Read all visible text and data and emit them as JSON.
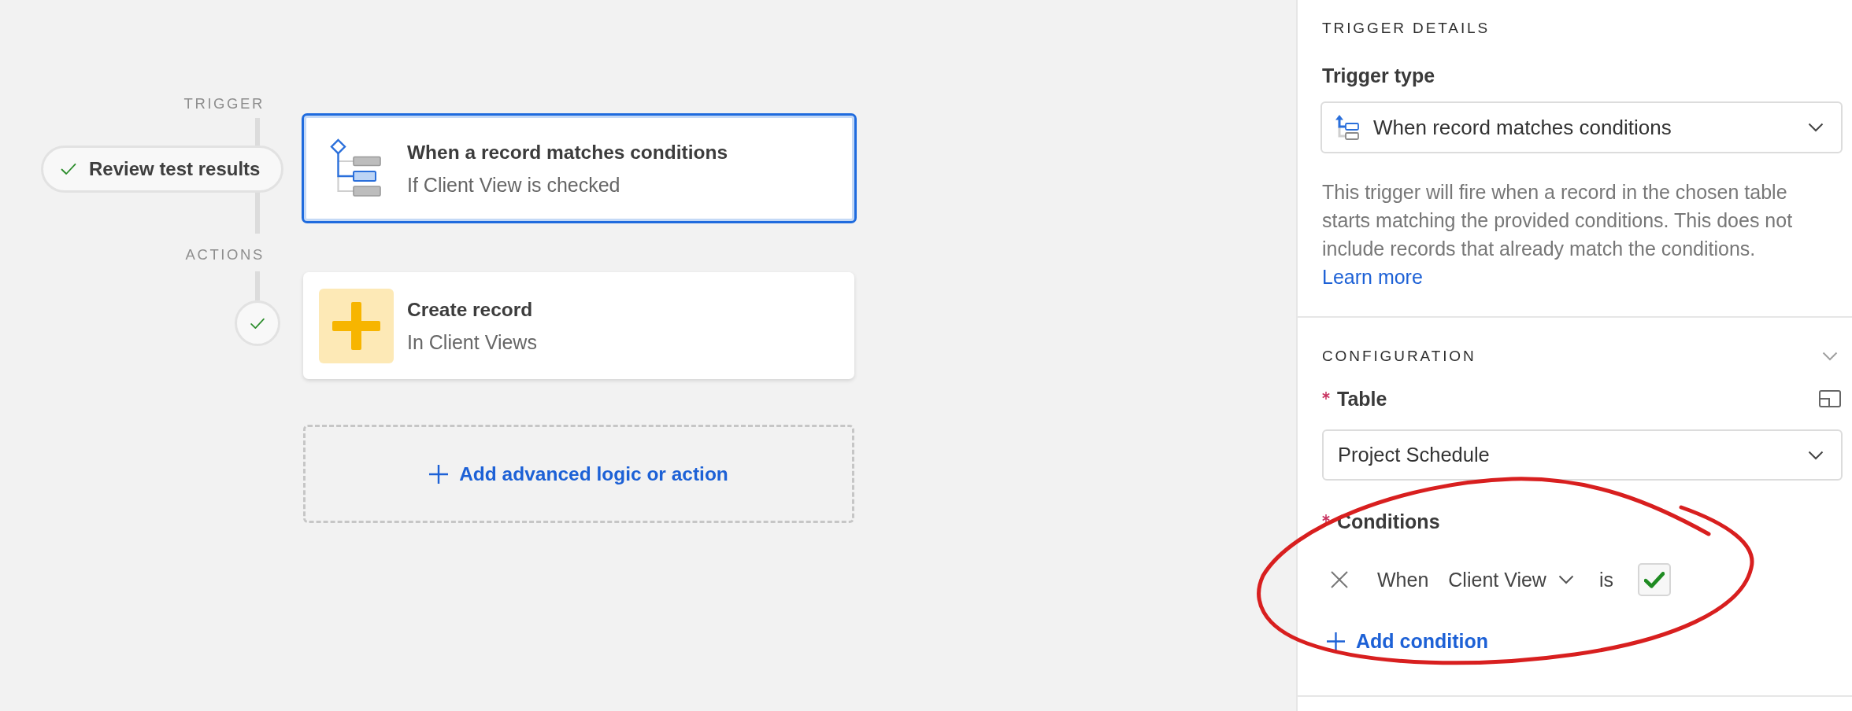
{
  "flow": {
    "trigger_label": "TRIGGER",
    "test_button": "Review test results",
    "trigger": {
      "title": "When a record matches conditions",
      "subtitle": "If Client View is checked",
      "selected": true
    },
    "actions_label": "ACTIONS",
    "actions": [
      {
        "kind": "create_record",
        "title": "Create record",
        "subtitle": "In Client Views",
        "selected": false,
        "tested": true
      }
    ],
    "add_step": "Add advanced logic or action"
  },
  "panel": {
    "heading": "TRIGGER DETAILS",
    "trigger_type": {
      "label": "Trigger type",
      "value": "When record matches conditions"
    },
    "description": "This trigger will fire when a record in the chosen table starts matching the provided conditions. This does not include records that already match the conditions.",
    "learn_more": "Learn more",
    "configuration": {
      "heading": "CONFIGURATION",
      "expanded": true,
      "table": {
        "label": "Table",
        "required": true,
        "value": "Project Schedule"
      },
      "conditions": {
        "label": "Conditions",
        "required": true,
        "rows": [
          {
            "prefix": "When",
            "field": "Client View",
            "operator": "is",
            "checked": true
          }
        ],
        "add_label": "Add condition"
      }
    }
  },
  "annotations": [
    {
      "kind": "ellipse"
    }
  ]
}
